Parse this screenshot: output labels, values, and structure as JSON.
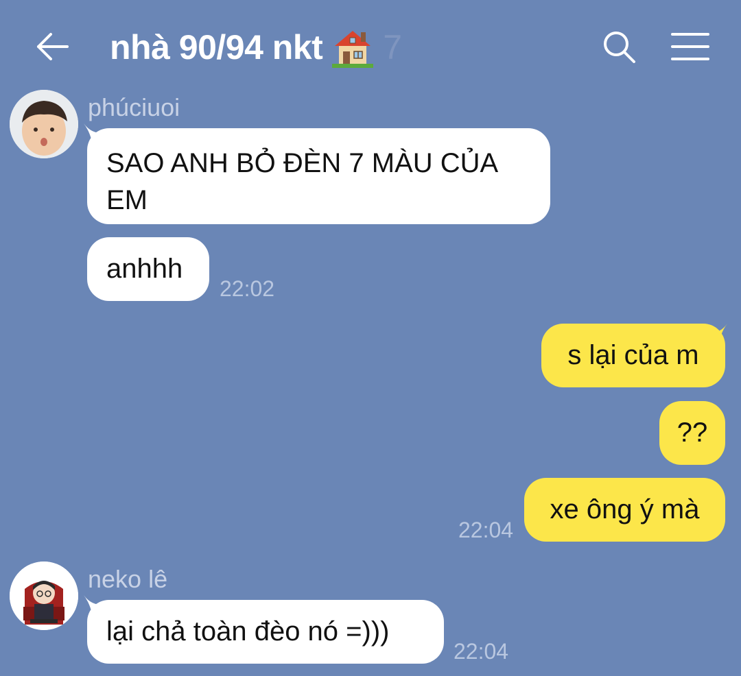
{
  "header": {
    "title": "nhà 90/94 nkt",
    "title_emoji_icon": "house-with-garden-icon",
    "member_count": "7",
    "back_icon": "arrow-left-icon",
    "search_icon": "search-icon",
    "menu_icon": "hamburger-menu-icon"
  },
  "colors": {
    "background": "#6a86b6",
    "incoming_bubble": "#ffffff",
    "outgoing_bubble": "#fce64a",
    "sender_name": "#c8d2e6",
    "timestamp": "#b9c7e0"
  },
  "messages": [
    {
      "sender": "phúciuoi",
      "direction": "incoming",
      "text_line1": "SAO ANH BỎ ĐÈN 7 MÀU CỦA",
      "text_line2": "EM"
    },
    {
      "direction": "incoming",
      "text": "anhhh",
      "time": "22:02"
    },
    {
      "direction": "outgoing",
      "text": "s lại của m"
    },
    {
      "direction": "outgoing",
      "text": "??"
    },
    {
      "direction": "outgoing",
      "text": "xe ông ý mà",
      "time": "22:04"
    },
    {
      "sender": "neko lê",
      "direction": "incoming",
      "text": "lại chả toàn đèo nó =)))",
      "time": "22:04"
    }
  ]
}
